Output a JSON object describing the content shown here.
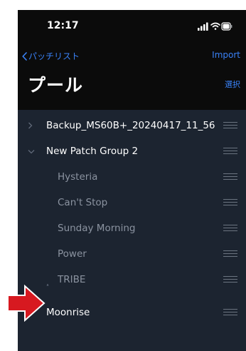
{
  "status": {
    "time": "12:17"
  },
  "nav": {
    "back_label": "パッチリスト",
    "import_label": "Import"
  },
  "header": {
    "title": "プール",
    "select_label": "選択"
  },
  "list": {
    "groups": [
      {
        "name": "Backup_MS60B+_20240417_11_56",
        "expanded": false
      },
      {
        "name": "New Patch Group 2",
        "expanded": true
      }
    ],
    "children": [
      "Hysteria",
      "Can't Stop",
      "Sunday Morning",
      "Power",
      "TRIBE"
    ],
    "loose_item": "Moonrise"
  },
  "colors": {
    "accent": "#3a82f7",
    "background": "#1c2430",
    "header_bg": "#0b0b0b",
    "arrow": "#d71920"
  },
  "icons": [
    "chevron-right-icon",
    "chevron-down-icon",
    "drag-handle-icon",
    "back-chevron-icon",
    "signal-icon",
    "wifi-icon",
    "battery-icon"
  ]
}
